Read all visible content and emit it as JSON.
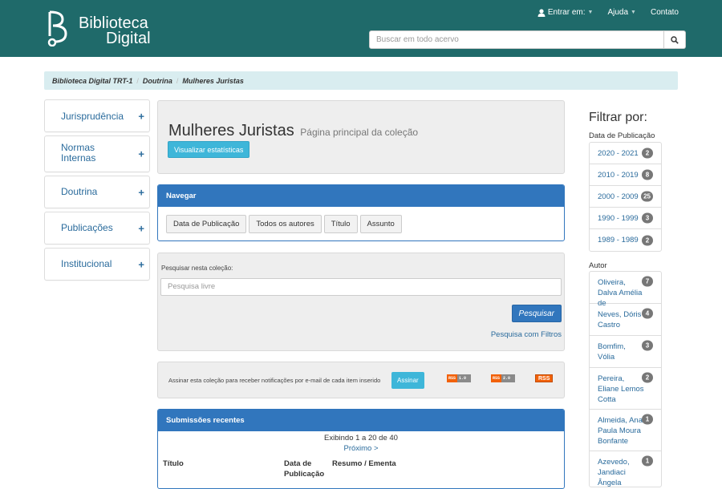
{
  "header": {
    "logo_line1": "Biblioteca",
    "logo_line2": "Digital",
    "nav": [
      {
        "label": "Entrar em:",
        "has_caret": true,
        "icon": "user-icon"
      },
      {
        "label": "Ajuda",
        "has_caret": true
      },
      {
        "label": "Contato",
        "has_caret": false
      }
    ],
    "search_placeholder": "Buscar em todo acervo"
  },
  "breadcrumb": [
    "Biblioteca Digital TRT-1",
    "Doutrina",
    "Mulheres Juristas"
  ],
  "sidebar": {
    "items": [
      {
        "label": "Jurisprudência"
      },
      {
        "label": "Normas Internas"
      },
      {
        "label": "Doutrina"
      },
      {
        "label": "Publicações"
      },
      {
        "label": "Institucional"
      }
    ]
  },
  "collection": {
    "title": "Mulheres Juristas",
    "subtitle": "Página principal da coleção",
    "stats_button": "Visualizar estatísticas"
  },
  "browse": {
    "title": "Navegar",
    "buttons": [
      "Data de Publicação",
      "Todos os autores",
      "Título",
      "Assunto"
    ]
  },
  "collection_search": {
    "label": "Pesquisar nesta coleção:",
    "placeholder": "Pesquisa livre",
    "button": "Pesquisar",
    "filters_link": "Pesquisa com Filtros"
  },
  "subscribe": {
    "text": "Assinar esta coleção para receber notificações por e-mail de cada item inserido",
    "button": "Assinar",
    "rss": [
      {
        "a": "RSS",
        "b": "1.0"
      },
      {
        "a": "RSS",
        "b": "2.0"
      }
    ],
    "rss_big": "RSS"
  },
  "recent": {
    "title": "Submissões recentes",
    "showing": "Exibindo 1 a 20 de 40",
    "next": "Próximo >",
    "columns": [
      "Título",
      "Data de Publicação",
      "Resumo / Ementa"
    ]
  },
  "filters": {
    "title": "Filtrar por:",
    "date_label": "Data de Publicação",
    "dates": [
      {
        "label": "2020 - 2021",
        "count": "2"
      },
      {
        "label": "2010 - 2019",
        "count": "8"
      },
      {
        "label": "2000 - 2009",
        "count": "25"
      },
      {
        "label": "1990 - 1999",
        "count": "3"
      },
      {
        "label": "1989 - 1989",
        "count": "2"
      }
    ],
    "author_label": "Autor",
    "authors": [
      {
        "label": "Oliveira, Dalva Amélia de",
        "count": "7"
      },
      {
        "label": "Neves, Dóris Castro",
        "count": "4"
      },
      {
        "label": "Bomfim, Vólia",
        "count": "3"
      },
      {
        "label": "Pereira, Eliane Lemos Cotta",
        "count": "2"
      },
      {
        "label": "Almeida, Ana Paula Moura Bonfante",
        "count": "1"
      },
      {
        "label": "Azevedo, Jandiaci Ângela",
        "count": "1"
      }
    ]
  }
}
